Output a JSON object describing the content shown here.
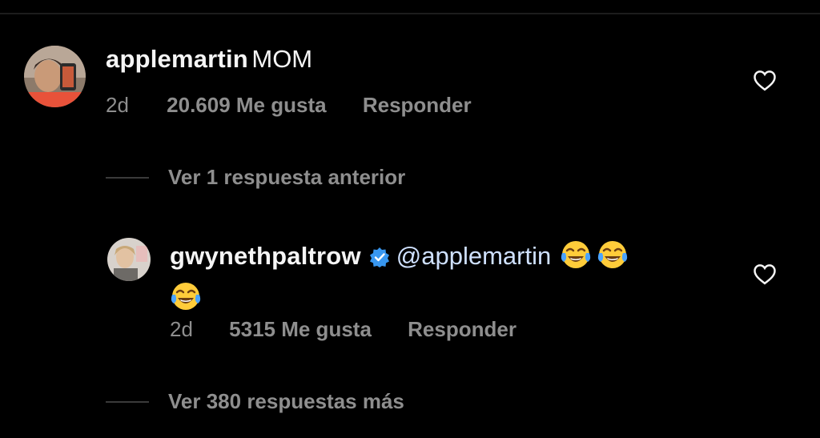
{
  "comment1": {
    "username": "applemartin",
    "text": "MOM",
    "time": "2d",
    "likes": "20.609 Me gusta",
    "reply": "Responder"
  },
  "view_previous": "Ver 1 respuesta anterior",
  "comment2": {
    "username": "gwynethpaltrow",
    "mention": "@applemartin",
    "emoji": [
      "face-with-tears-of-joy",
      "face-with-tears-of-joy",
      "face-with-tears-of-joy"
    ],
    "verified_icon": "verified-badge-icon",
    "time": "2d",
    "likes": "5315 Me gusta",
    "reply": "Responder"
  },
  "view_more": "Ver 380 respuestas más",
  "colors": {
    "background": "#000000",
    "text": "#f5f5f5",
    "muted": "#8e8e8e",
    "verified": "#3897f0",
    "mention": "#cfe1ff"
  }
}
